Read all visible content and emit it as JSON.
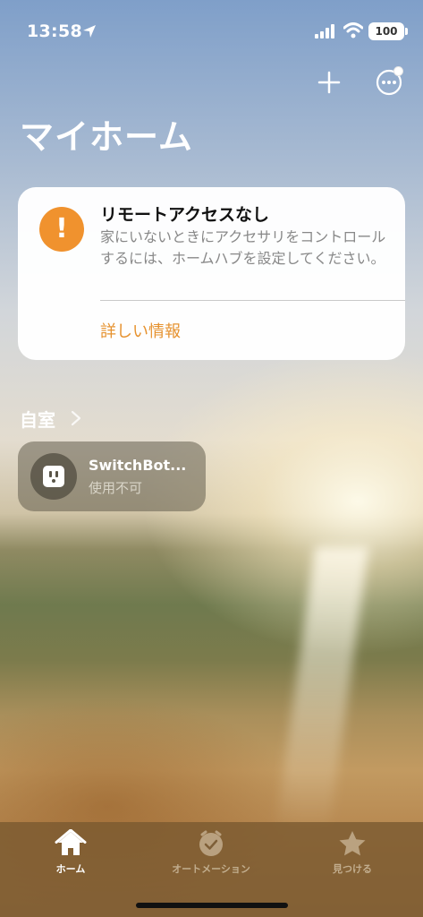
{
  "status_bar": {
    "time": "13:58",
    "battery": "100"
  },
  "header": {
    "title": "マイホーム"
  },
  "alert": {
    "title": "リモートアクセスなし",
    "body": "家にいないときにアクセサリをコントロールするには、ホームハブを設定してください。",
    "link": "詳しい情報"
  },
  "section": {
    "title": "自室"
  },
  "accessory": {
    "name": "SwitchBot...",
    "status": "使用不可"
  },
  "tabs": [
    {
      "label": "ホーム",
      "icon": "house-icon",
      "active": true
    },
    {
      "label": "オートメーション",
      "icon": "clock-check-icon",
      "active": false
    },
    {
      "label": "見つける",
      "icon": "star-icon",
      "active": false
    }
  ],
  "colors": {
    "accent": "#f0922e",
    "link": "#e6922f"
  }
}
